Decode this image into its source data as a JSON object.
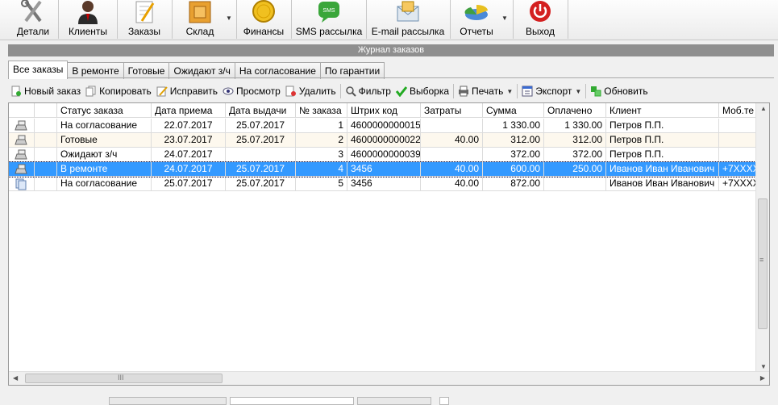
{
  "toolbar": {
    "items": [
      {
        "label": "Детали",
        "icon": "tools-icon"
      },
      {
        "label": "Клиенты",
        "icon": "clients-icon"
      },
      {
        "label": "Заказы",
        "icon": "orders-icon"
      },
      {
        "label": "Склад",
        "icon": "warehouse-icon"
      },
      {
        "label": "Финансы",
        "icon": "coin-icon"
      },
      {
        "label": "SMS рассылка",
        "icon": "sms-icon"
      },
      {
        "label": "E-mail рассылка",
        "icon": "email-icon"
      },
      {
        "label": "Отчеты",
        "icon": "reports-icon"
      },
      {
        "label": "Выход",
        "icon": "power-icon"
      }
    ]
  },
  "journal": {
    "title": "Журнал заказов"
  },
  "tabs": [
    "Все заказы",
    "В ремонте",
    "Готовые",
    "Ожидают з/ч",
    "На согласование",
    "По гарантии"
  ],
  "actions": {
    "new_order": "Новый заказ",
    "copy": "Копировать",
    "edit": "Исправить",
    "view": "Просмотр",
    "delete": "Удалить",
    "filter": "Фильтр",
    "select": "Выборка",
    "print": "Печать",
    "export": "Экспорт",
    "refresh": "Обновить"
  },
  "grid": {
    "columns": [
      "Статус заказа",
      "Дата приема",
      "Дата выдачи",
      "№ заказа",
      "Штрих код",
      "Затраты",
      "Сумма",
      "Оплачено",
      "Клиент",
      "Моб.те"
    ],
    "rows": [
      {
        "status": "На согласование",
        "received": "22.07.2017",
        "issued": "25.07.2017",
        "number": "1",
        "barcode": "4600000000015",
        "costs": "",
        "sum": "1 330.00",
        "paid": "1 330.00",
        "client": "Петров П.П.",
        "mobile": ""
      },
      {
        "status": "Готовые",
        "received": "23.07.2017",
        "issued": "25.07.2017",
        "number": "2",
        "barcode": "4600000000022",
        "costs": "40.00",
        "sum": "312.00",
        "paid": "312.00",
        "client": "Петров П.П.",
        "mobile": ""
      },
      {
        "status": "Ожидают з/ч",
        "received": "24.07.2017",
        "issued": "",
        "number": "3",
        "barcode": "4600000000039",
        "costs": "",
        "sum": "372.00",
        "paid": "372.00",
        "client": "Петров П.П.",
        "mobile": ""
      },
      {
        "status": "В ремонте",
        "received": "24.07.2017",
        "issued": "25.07.2017",
        "number": "4",
        "barcode": "3456",
        "costs": "40.00",
        "sum": "600.00",
        "paid": "250.00",
        "client": "Иванов Иван Иванович",
        "mobile": "+7XXXX"
      },
      {
        "status": "На согласование",
        "received": "25.07.2017",
        "issued": "25.07.2017",
        "number": "5",
        "barcode": "3456",
        "costs": "40.00",
        "sum": "872.00",
        "paid": "",
        "client": "Иванов Иван Иванович",
        "mobile": "+7XXXX"
      }
    ],
    "selected_row": 3
  },
  "scroll": {
    "hthumb_label": "III",
    "vthumb_label": "≡"
  }
}
